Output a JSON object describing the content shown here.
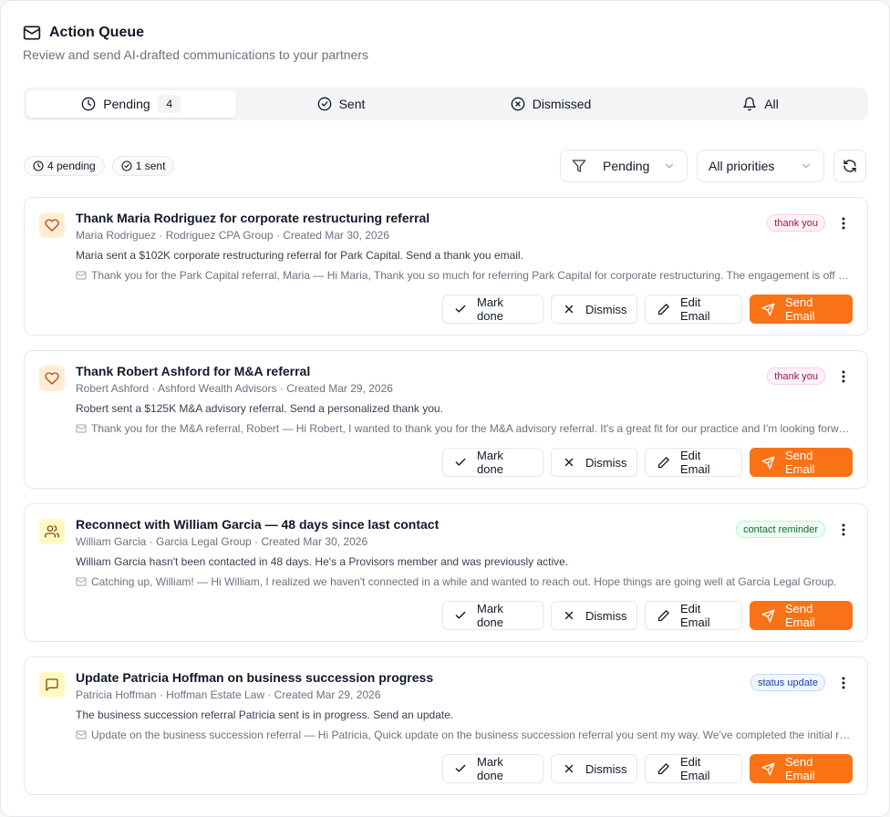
{
  "header": {
    "title": "Action Queue",
    "subtitle": "Review and send AI-drafted communications to your partners",
    "icon": "mail-icon"
  },
  "tabs": [
    {
      "label": "Pending",
      "count": "4",
      "icon": "clock-icon",
      "active": true
    },
    {
      "label": "Sent",
      "icon": "check-circle-icon"
    },
    {
      "label": "Dismissed",
      "icon": "x-circle-icon"
    },
    {
      "label": "All",
      "icon": "bell-icon"
    }
  ],
  "summary": {
    "pending": "4 pending",
    "sent": "1 sent"
  },
  "filters": {
    "status": "Pending",
    "priority": "All priorities"
  },
  "actions": {
    "mark_done": "Mark done",
    "dismiss": "Dismiss",
    "edit_email": "Edit Email",
    "send_email": "Send Email"
  },
  "colors": {
    "accent": "#f97316",
    "thank_you_bg": "#fdf2f8",
    "thank_you_text": "#9d174d",
    "contact_reminder_bg": "#ecfdf3",
    "contact_reminder_text": "#166534",
    "status_update_bg": "#eff6ff",
    "status_update_text": "#1e40af"
  },
  "cards": [
    {
      "icon": "heart-icon",
      "title": "Thank Maria Rodriguez for corporate restructuring referral",
      "meta": "Maria Rodriguez · Rodriguez CPA Group · Created Mar 30, 2026",
      "description": "Maria sent a $102K corporate restructuring referral for Park Capital. Send a thank you email.",
      "preview": "Thank you for the Park Capital referral, Maria — Hi Maria, Thank you so much for referring Park Capital for corporate restructuring. The engagement is off to a great start.",
      "tag": "thank you"
    },
    {
      "icon": "heart-icon",
      "title": "Thank Robert Ashford for M&A referral",
      "meta": "Robert Ashford · Ashford Wealth Advisors · Created Mar 29, 2026",
      "description": "Robert sent a $125K M&A advisory referral. Send a personalized thank you.",
      "preview": "Thank you for the M&A referral, Robert — Hi Robert, I wanted to thank you for the M&A advisory referral. It's a great fit for our practice and I'm looking forward to it.",
      "tag": "thank you"
    },
    {
      "icon": "users-icon",
      "title": "Reconnect with William Garcia — 48 days since last contact",
      "meta": "William Garcia · Garcia Legal Group · Created Mar 30, 2026",
      "description": "William Garcia hasn't been contacted in 48 days. He's a Provisors member and was previously active.",
      "preview": "Catching up, William! — Hi William, I realized we haven't connected in a while and wanted to reach out. Hope things are going well at Garcia Legal Group.",
      "tag": "contact reminder"
    },
    {
      "icon": "message-icon",
      "title": "Update Patricia Hoffman on business succession progress",
      "meta": "Patricia Hoffman · Hoffman Estate Law · Created Mar 29, 2026",
      "description": "The business succession referral Patricia sent is in progress. Send an update.",
      "preview": "Update on the business succession referral — Hi Patricia, Quick update on the business succession referral you sent my way. We've completed the initial review.",
      "tag": "status update"
    }
  ]
}
